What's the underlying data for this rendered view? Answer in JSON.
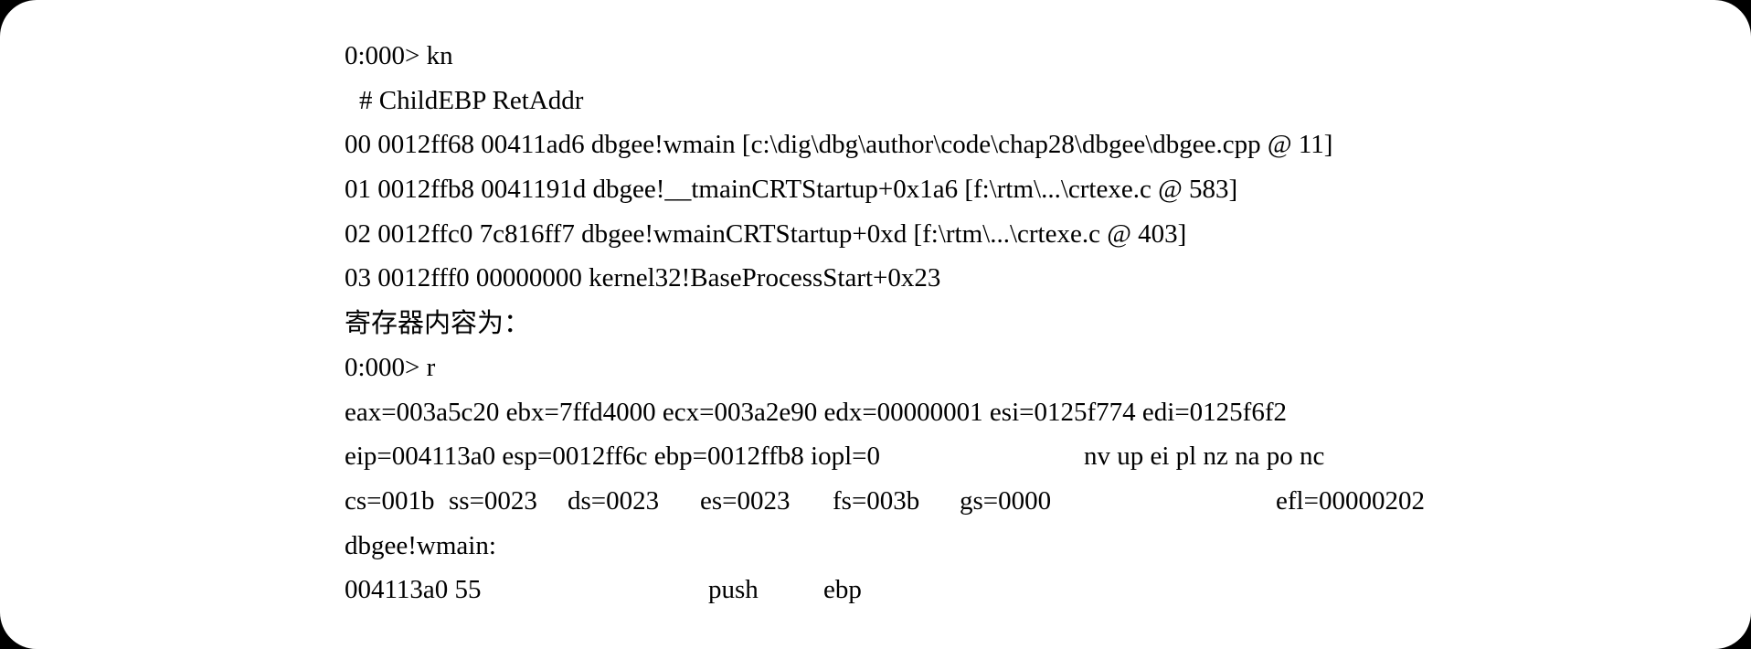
{
  "document": {
    "lines": {
      "kn_cmd": "0:000> kn",
      "stack_header": "# ChildEBP RetAddr",
      "frame_00": "00 0012ff68 00411ad6 dbgee!wmain [c:\\dig\\dbg\\author\\code\\chap28\\dbgee\\dbgee.cpp @ 11]",
      "frame_01": "01 0012ffb8 0041191d dbgee!__tmainCRTStartup+0x1a6 [f:\\rtm\\...\\crtexe.c @ 583]",
      "frame_02": "02 0012ffc0 7c816ff7 dbgee!wmainCRTStartup+0xd [f:\\rtm\\...\\crtexe.c @ 403]",
      "frame_03": "03 0012fff0 00000000 kernel32!BaseProcessStart+0x23",
      "registers_caption": "寄存器内容为：",
      "r_cmd": "0:000> r",
      "regs_line1": "eax=003a5c20 ebx=7ffd4000 ecx=003a2e90 edx=00000001 esi=0125f774 edi=0125f6f2",
      "regs_line2_left": "eip=004113a0 esp=0012ff6c ebp=0012ffb8 iopl=0",
      "regs_line2_flags": "nv up ei pl nz na po nc",
      "seg_cs": "cs=001b",
      "seg_ss": "ss=0023",
      "seg_ds": "ds=0023",
      "seg_es": "es=0023",
      "seg_fs": "fs=003b",
      "seg_gs": "gs=0000",
      "efl": "efl=00000202",
      "symbol": "dbgee!wmain:",
      "disasm_addr_bytes": "004113a0 55",
      "disasm_mnemonic": "push",
      "disasm_operand": "ebp"
    }
  }
}
